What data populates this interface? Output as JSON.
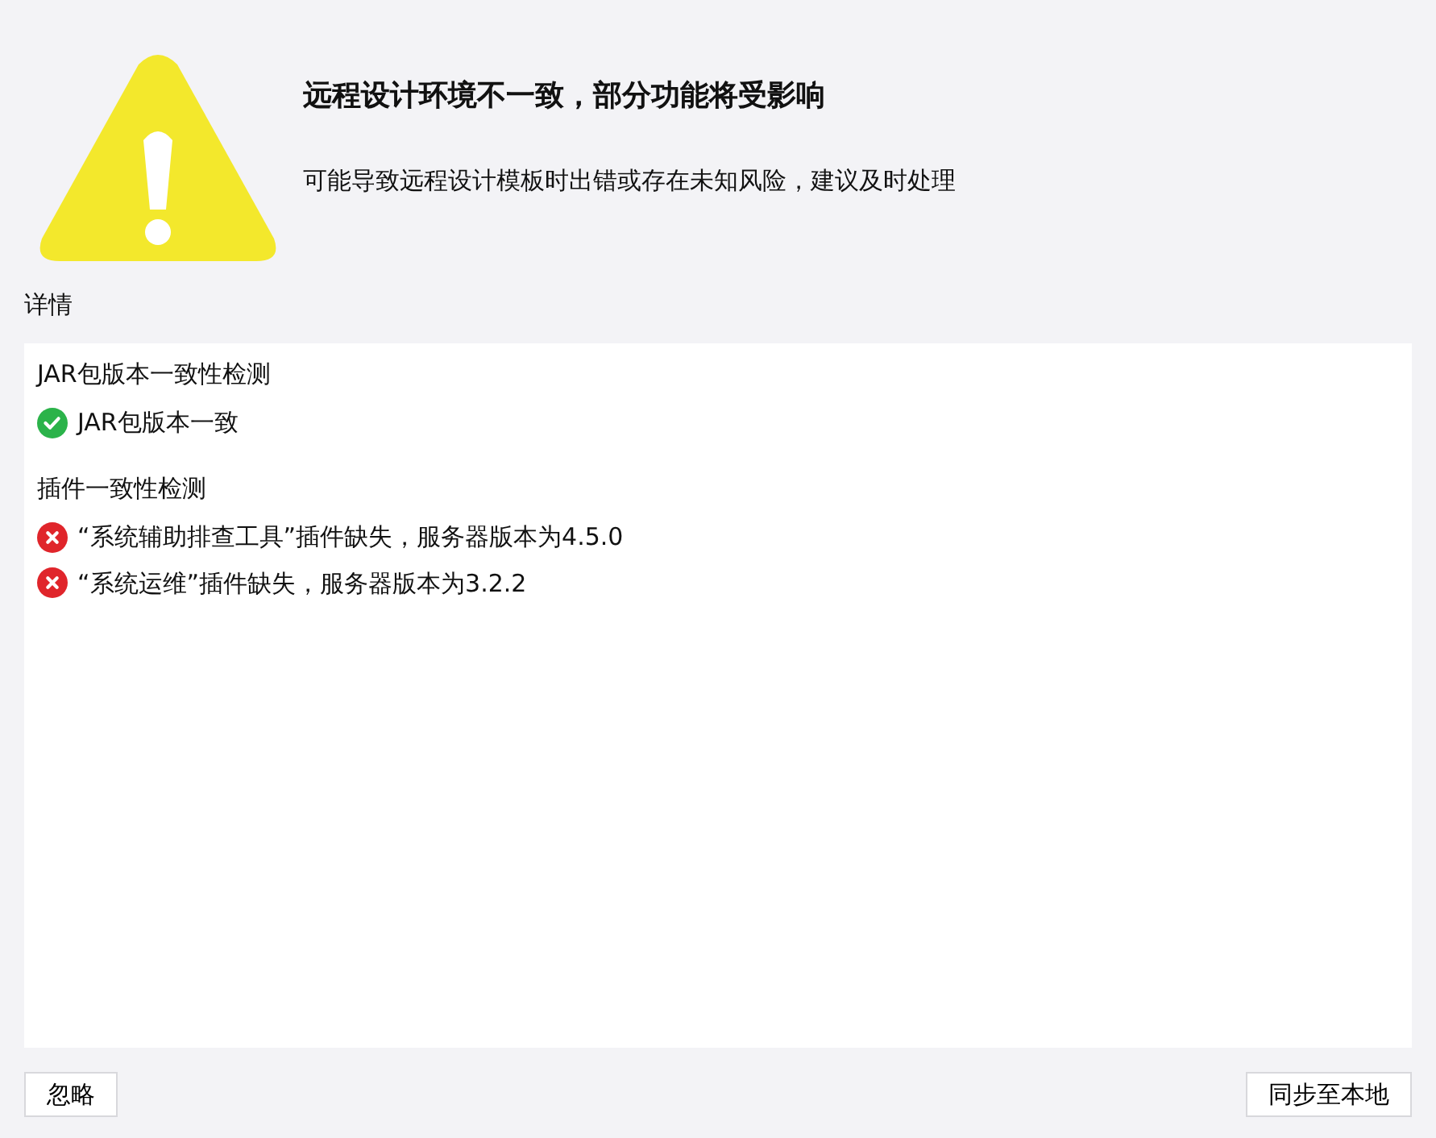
{
  "title": "远程设计环境不一致，部分功能将受影响",
  "message": "可能导致远程设计模板时出错或存在未知风险，建议及时处理",
  "details_label": "详情",
  "groups": [
    {
      "title": "JAR包版本一致性检测",
      "items": [
        {
          "passed": true,
          "text": "JAR包版本一致"
        }
      ]
    },
    {
      "title": "插件一致性检测",
      "items": [
        {
          "passed": false,
          "text": "“系统辅助排查工具”插件缺失，服务器版本为4.5.0"
        },
        {
          "passed": false,
          "text": "“系统运维”插件缺失，服务器版本为3.2.2"
        }
      ]
    }
  ],
  "buttons": {
    "left": "忽略",
    "right": "同步至本地"
  }
}
